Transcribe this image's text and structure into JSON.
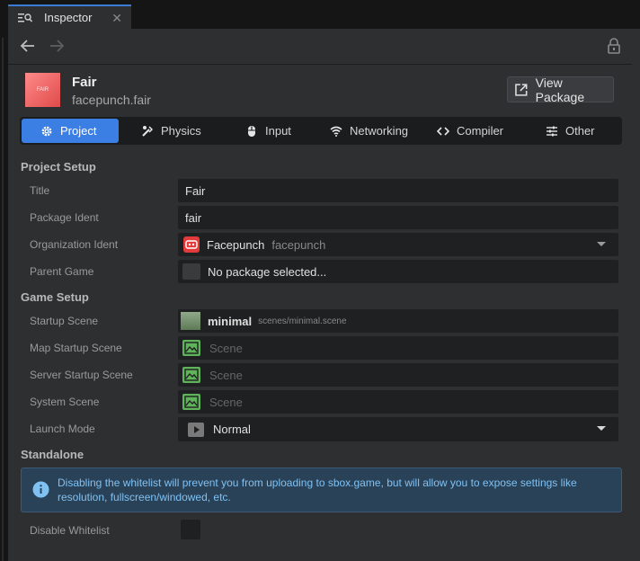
{
  "window": {
    "tab_title": "Inspector"
  },
  "header": {
    "title": "Fair",
    "ident": "facepunch.fair",
    "thumb_text": "FAIR",
    "view_button": "View Package"
  },
  "tabs": [
    {
      "label": "Project",
      "icon": "gear-icon",
      "active": true
    },
    {
      "label": "Physics",
      "icon": "physics-icon"
    },
    {
      "label": "Input",
      "icon": "mouse-icon"
    },
    {
      "label": "Networking",
      "icon": "wifi-icon"
    },
    {
      "label": "Compiler",
      "icon": "code-icon"
    },
    {
      "label": "Other",
      "icon": "sliders-icon"
    }
  ],
  "project_setup": {
    "heading": "Project Setup",
    "title_label": "Title",
    "title_value": "Fair",
    "package_ident_label": "Package Ident",
    "package_ident_value": "fair",
    "org_label": "Organization Ident",
    "org_name": "Facepunch",
    "org_ident": "facepunch",
    "parent_label": "Parent Game",
    "parent_value": "No package selected..."
  },
  "game_setup": {
    "heading": "Game Setup",
    "startup_label": "Startup Scene",
    "startup_name": "minimal",
    "startup_path": "scenes/minimal.scene",
    "map_label": "Map Startup Scene",
    "map_placeholder": "Scene",
    "server_label": "Server Startup Scene",
    "server_placeholder": "Scene",
    "system_label": "System Scene",
    "system_placeholder": "Scene",
    "launch_label": "Launch Mode",
    "launch_value": "Normal"
  },
  "standalone": {
    "heading": "Standalone",
    "info": "Disabling the whitelist will prevent you from uploading to sbox.game, but will allow you to expose settings like resolution, fullscreen/windowed, etc.",
    "disable_label": "Disable Whitelist",
    "disable_checked": false
  },
  "colors": {
    "accent": "#3b7ee4",
    "info_bg": "#2a4258",
    "info_text": "#7fc1f3",
    "org_red": "#e23b3b",
    "scene_green": "#5fb35a"
  }
}
